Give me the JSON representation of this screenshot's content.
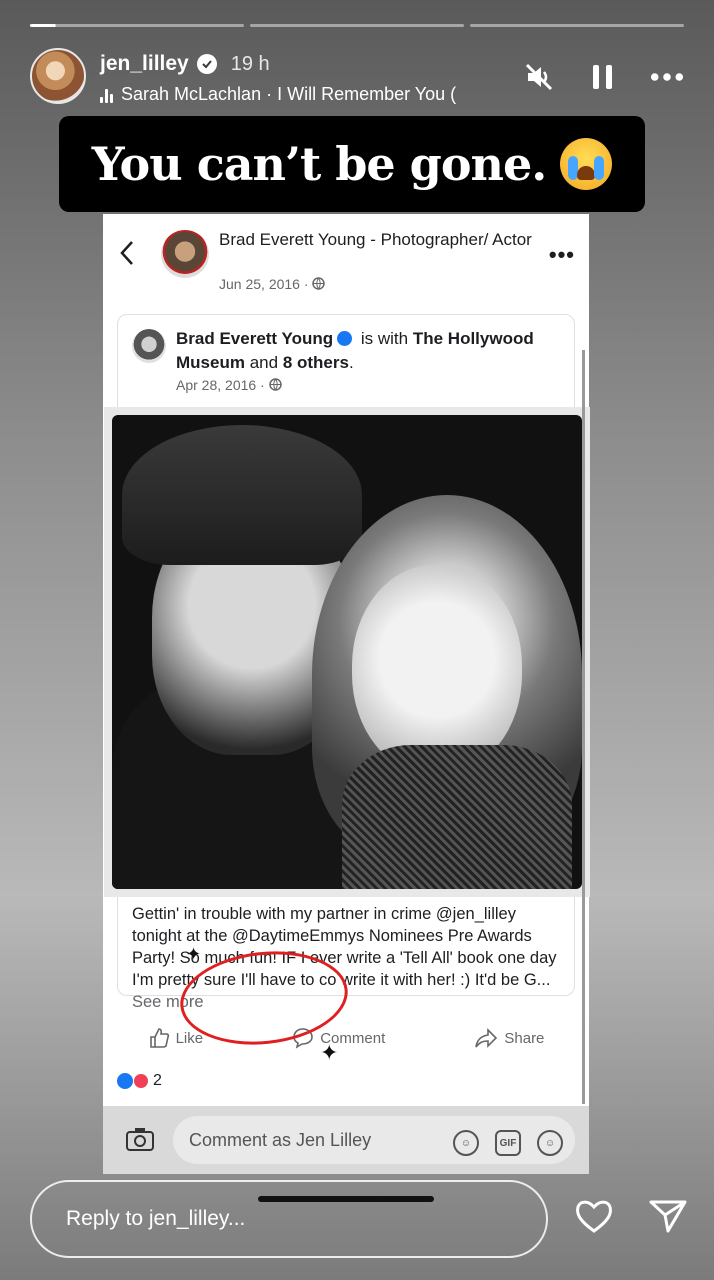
{
  "story": {
    "progress": {
      "segments": 3,
      "current_index": 0
    },
    "username": "jen_lilley",
    "time_ago": "19 h",
    "music": "Sarah McLachlan · I Will Remember You (",
    "caption": "You can’t be gone.",
    "caption_emoji": "loudly-crying-face"
  },
  "fb_post": {
    "author": "Brad Everett Young - Photographer/ Actor",
    "date": "Jun 25, 2016 ·",
    "shared": {
      "author": "Brad Everett Young",
      "is_with_text": "is with",
      "tagged_place": "The Hollywood Museum",
      "and_text": "and",
      "others": "8 others",
      "date": "Apr 28, 2016 ·",
      "text": "Gettin' in trouble with my partner in crime @jen_lilley tonight at the @DaytimeEmmys Nominees Pre Awards Party! So much fun! IF I ever write a 'Tell All' book one day I'm pretty sure I'll have to co write it with her! :) It'd be G...",
      "see_more": "See more"
    },
    "actions": {
      "like": "Like",
      "comment": "Comment",
      "share": "Share"
    },
    "reaction_count": "2",
    "comment_placeholder": "Comment as Jen Lilley",
    "gif_label": "GIF"
  },
  "reply": {
    "placeholder": "Reply to jen_lilley..."
  },
  "colors": {
    "fb_blue": "#1877f2",
    "love_red": "#f33e58",
    "annotation_red": "#e02020"
  }
}
